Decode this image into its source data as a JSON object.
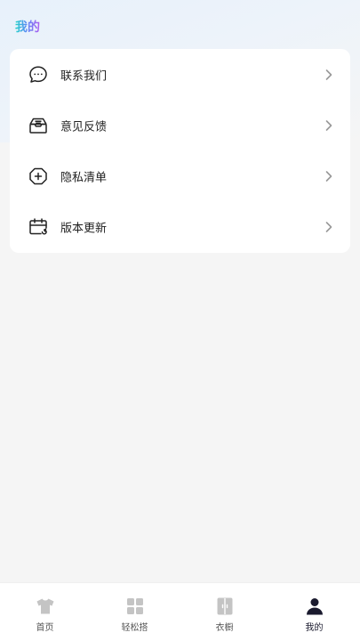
{
  "header": {
    "title": "我的"
  },
  "menu": {
    "items": [
      {
        "label": "联系我们",
        "icon": "chat-bubble-icon"
      },
      {
        "label": "意见反馈",
        "icon": "mail-tray-icon"
      },
      {
        "label": "隐私清单",
        "icon": "shield-plus-icon"
      },
      {
        "label": "版本更新",
        "icon": "calendar-refresh-icon"
      }
    ]
  },
  "tabbar": {
    "tabs": [
      {
        "label": "首页",
        "icon": "tshirt-icon",
        "active": false
      },
      {
        "label": "轻松搭",
        "icon": "grid-icon",
        "active": false
      },
      {
        "label": "衣橱",
        "icon": "wardrobe-icon",
        "active": false
      },
      {
        "label": "我的",
        "icon": "person-icon",
        "active": true
      }
    ]
  },
  "colors": {
    "background": "#f5f5f5",
    "card": "#ffffff",
    "text": "#222222",
    "inactive_icon": "#c4c4c4",
    "active_icon": "#1a1a2e",
    "title_gradient": [
      "#23d6c8",
      "#5b8cf5",
      "#b25cf0"
    ]
  }
}
